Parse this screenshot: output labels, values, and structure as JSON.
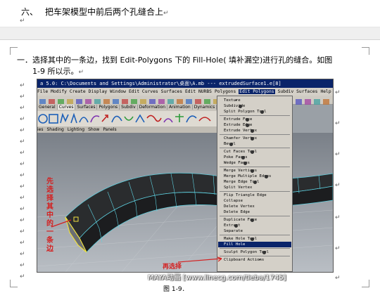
{
  "heading": {
    "number": "六、",
    "text": "把车架模型中前后两个孔缝合上"
  },
  "step": {
    "line1": "一．选择其中的一条边，找到 Edit-Polygons 下的 Fill-Hole( 填补漏空)进行孔的缝合。如图",
    "line2": "1-9 所以示。"
  },
  "paragraph_mark": "↵",
  "screenshot": {
    "title": "a 5.0: C:\\Documents and Settings\\Administrator\\桌面\\A.mb  ---  extrudedSurface1.e[8]",
    "menus": [
      "File",
      "Modify",
      "Create",
      "Display",
      "Window",
      "Edit Curves",
      "Surfaces",
      "Edit NURBS",
      "Polygons",
      "Edit Polygons",
      "Subdiv Surfaces",
      "Help"
    ],
    "active_menu": "Edit Polygons",
    "shelf_tabs": [
      "General",
      "Curves",
      "Surfaces",
      "Polygons",
      "Subdiv",
      "Deformation",
      "Animation",
      "Dynamics",
      "Rendering"
    ],
    "selected_shelf_tab": "Curves",
    "panel_menus": [
      "Shading",
      "Lighting",
      "Show",
      "Panels"
    ],
    "panel_menu_prefix": "ies",
    "dropdown": {
      "items": [
        {
          "label": "Texture",
          "option": false,
          "submenu": true
        },
        {
          "label": "Subdivide",
          "option": true
        },
        {
          "label": "Split Polygon Tool",
          "option": true
        },
        {
          "sep": true
        },
        {
          "label": "Extrude Face",
          "option": true
        },
        {
          "label": "Extrude Edge",
          "option": true
        },
        {
          "label": "Extrude Vertex",
          "option": true
        },
        {
          "sep": true
        },
        {
          "label": "Chamfer Vertex",
          "option": true
        },
        {
          "label": "Bevel",
          "option": true
        },
        {
          "sep": true
        },
        {
          "label": "Cut Faces Tool",
          "option": true
        },
        {
          "label": "Poke Faces",
          "option": true
        },
        {
          "label": "Wedge Faces",
          "option": true
        },
        {
          "sep": true
        },
        {
          "label": "Merge Vertices",
          "option": true
        },
        {
          "label": "Merge Multiple Edges",
          "option": true
        },
        {
          "label": "Merge Edge Tool",
          "option": true
        },
        {
          "label": "Split Vertex",
          "option": false
        },
        {
          "sep": true
        },
        {
          "label": "Flip Triangle Edge",
          "option": false
        },
        {
          "label": "Collapse",
          "option": false
        },
        {
          "label": "Delete Vertex",
          "option": false
        },
        {
          "label": "Delete Edge",
          "option": false
        },
        {
          "sep": true
        },
        {
          "label": "Duplicate Face",
          "option": true
        },
        {
          "label": "Extract",
          "option": true
        },
        {
          "label": "Separate",
          "option": false
        },
        {
          "sep": true
        },
        {
          "label": "Make Hole Tool",
          "option": true
        },
        {
          "label": "Fill Hole",
          "option": false,
          "highlight": true
        },
        {
          "sep": true
        },
        {
          "label": "Sculpt Polygon Tool",
          "option": true
        },
        {
          "sep": true
        },
        {
          "label": "Clipboard Actions",
          "option": false,
          "submenu": true
        }
      ]
    },
    "annotation_vertical": "先选择其中的一条边",
    "annotation_horizontal": "再选择"
  },
  "watermark": "MAYA动画 [www.linecg.com/tieba/1745]",
  "caption": "图 1-9．",
  "colors": {
    "menu_bg": "#d4d0c8",
    "title_bg": "#0a246a",
    "annotation_red": "#d42020",
    "mesh_edge": "#5ed1e0"
  }
}
